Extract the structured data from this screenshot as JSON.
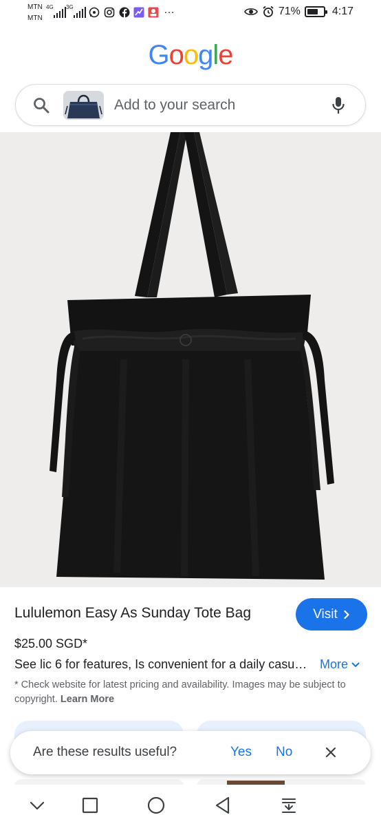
{
  "status_bar": {
    "carrier_1": "MTN",
    "carrier_2": "MTN",
    "network_1": "4G",
    "network_2": "3G",
    "battery_percent": "71%",
    "battery_level": 0.71,
    "time": "4:17",
    "more_indicator": "…"
  },
  "logo": {
    "letters": [
      "G",
      "o",
      "o",
      "g",
      "l",
      "e"
    ],
    "colors": [
      "#4285F4",
      "#EA4335",
      "#FBBC05",
      "#4285F4",
      "#34A853",
      "#EA4335"
    ]
  },
  "search": {
    "placeholder": "Add to your search"
  },
  "product": {
    "title": "Lululemon Easy As Sunday Tote Bag",
    "visit_label": "Visit",
    "price": "$25.00 SGD*",
    "description": "See lic 6 for features, Is convenient for a daily casu…",
    "more_label": "More",
    "disclaimer": "* Check website for latest pricing and availability. Images may be subject to copyright.",
    "learn_more_label": "Learn More"
  },
  "feedback": {
    "question": "Are these results useful?",
    "yes_label": "Yes",
    "no_label": "No"
  },
  "colors": {
    "accent": "#1a73e8",
    "image_background": "#efedeb",
    "bag": "#151515"
  }
}
